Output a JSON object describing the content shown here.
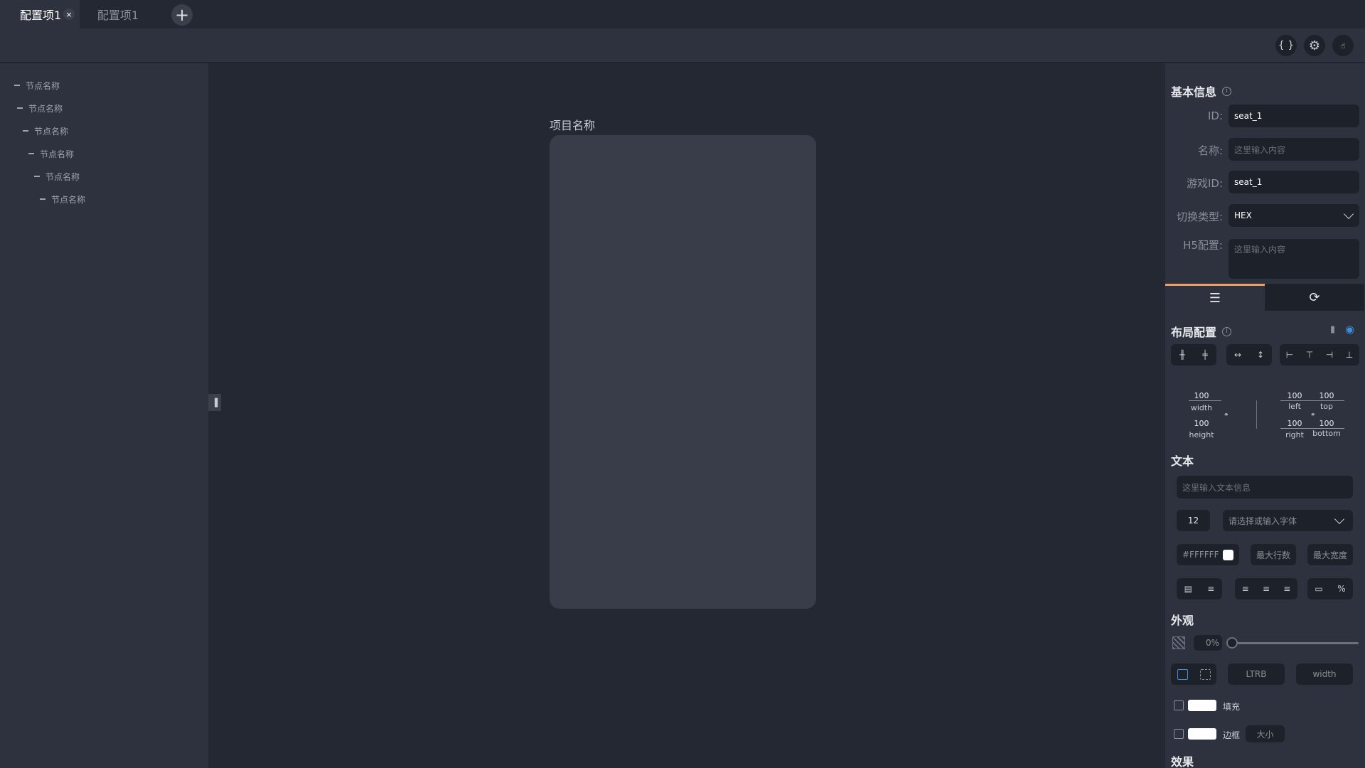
{
  "tabs": [
    {
      "label": "配置项1",
      "active": true
    },
    {
      "label": "配置项1",
      "active": false
    }
  ],
  "tab_close_icon": "×",
  "toolbar": {
    "icons": [
      "code-braces-icon",
      "gear-icon",
      "pointer-icon"
    ],
    "code_glyph": "{ }",
    "gear_glyph": "⚙",
    "pointer_glyph": "☝"
  },
  "tree": {
    "items": [
      "节点名称",
      "节点名称",
      "节点名称",
      "节点名称",
      "节点名称",
      "节点名称"
    ]
  },
  "canvas": {
    "label": "项目名称"
  },
  "basic_info": {
    "title": "基本信息",
    "id_label": "ID:",
    "id_value": "seat_1",
    "name_label": "名称:",
    "name_placeholder": "这里输入内容",
    "game_id_label": "游戏ID:",
    "game_id_value": "seat_1",
    "switch_type_label": "切换类型:",
    "switch_type_value": "HEX",
    "h5_label": "H5配置:",
    "h5_placeholder": "这里输入内容"
  },
  "layout": {
    "title": "布局配置",
    "width_value": "100",
    "width_label": "width",
    "height_value": "100",
    "height_label": "height",
    "left_value": "100",
    "left_label": "left",
    "top_value": "100",
    "top_label": "top",
    "right_value": "100",
    "right_label": "right",
    "bottom_value": "100",
    "bottom_label": "bottom"
  },
  "text": {
    "title": "文本",
    "text_placeholder": "这里输入文本信息",
    "font_size": "12",
    "font_placeholder": "请选择或输入字体",
    "color_value": "#FFFFFF",
    "max_lines": "最大行数",
    "max_width": "最大宽度"
  },
  "appearance": {
    "title": "外观",
    "opacity": "0%",
    "ltrb": "LTRB",
    "width": "width",
    "fill_label": "填充",
    "border_label": "边框",
    "size_label": "大小"
  },
  "effects": {
    "title": "效果"
  },
  "colors": {
    "accent": "#f29b63",
    "eye": "#3d8fe0"
  }
}
